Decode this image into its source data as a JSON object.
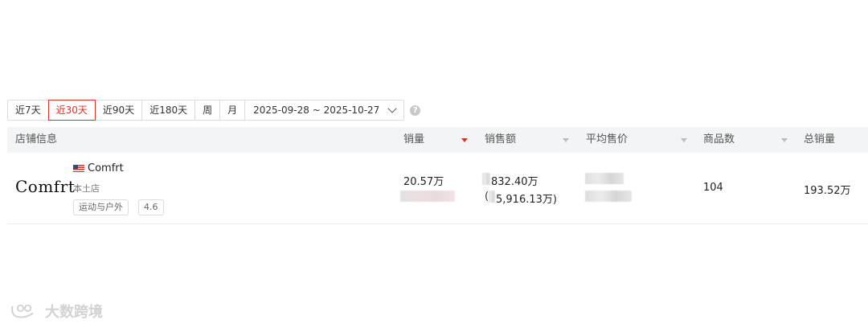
{
  "filters": {
    "buttons": [
      {
        "label": "近7天",
        "active": false
      },
      {
        "label": "近30天",
        "active": true
      },
      {
        "label": "近90天",
        "active": false
      },
      {
        "label": "近180天",
        "active": false
      },
      {
        "label": "周",
        "active": false
      },
      {
        "label": "月",
        "active": false
      }
    ],
    "date_range": "2025-09-28 ~ 2025-10-27",
    "help_icon": "question-circle-icon"
  },
  "table": {
    "headers": {
      "store_info": "店铺信息",
      "sales_volume": "销量",
      "sales_amount": "销售额",
      "avg_price": "平均售价",
      "product_count": "商品数",
      "total_sales": "总销量"
    },
    "sorted_column": "sales_volume",
    "sort_color": "#d4332c",
    "rows": [
      {
        "logo_text": "Comfrt",
        "flag_icon": "us-flag-icon",
        "store_name": "Comfrt",
        "store_type": "本土店",
        "category_tag": "运动与户外",
        "rating": "4.6",
        "sales_volume": "20.57万",
        "sales_amount": "832.40万",
        "sales_amount_sub": "5,916.13万)",
        "product_count": "104",
        "total_sales": "193.52万"
      }
    ]
  },
  "watermark": {
    "text": "大数跨境",
    "icon": "brand-logo-icon"
  },
  "accent_color": "#d4332c"
}
